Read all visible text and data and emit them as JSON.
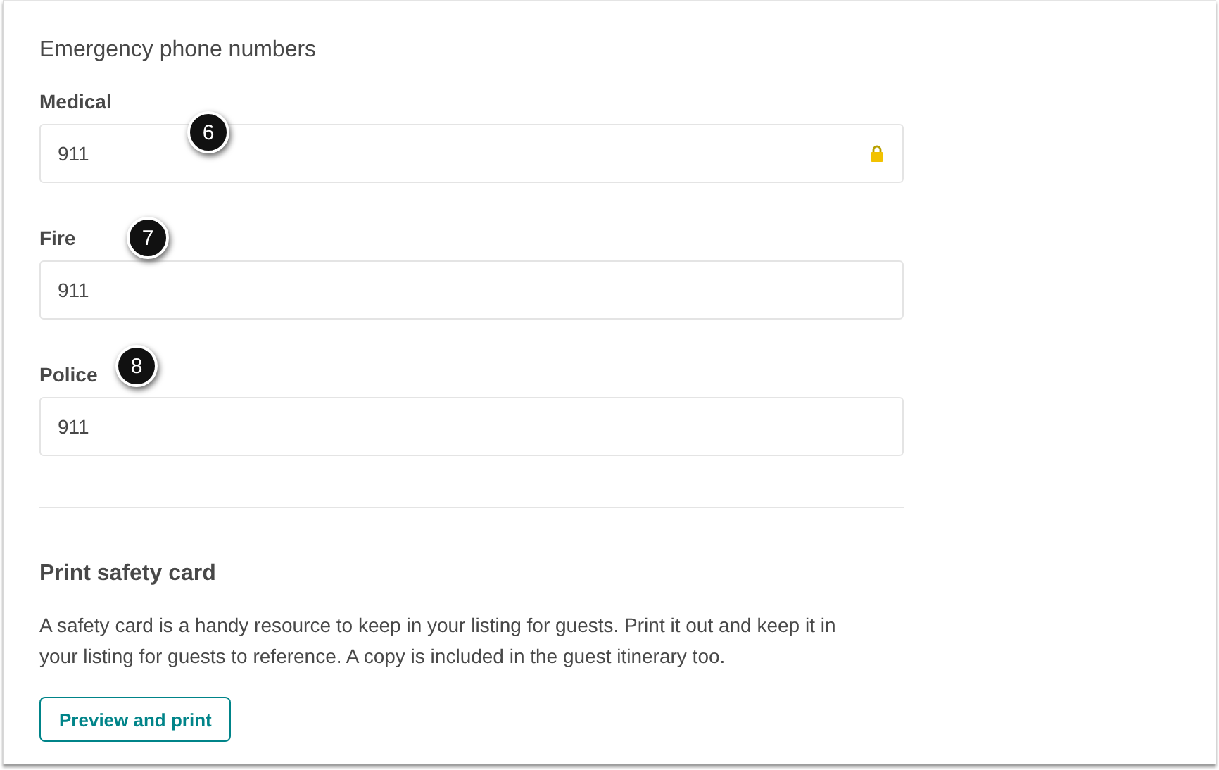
{
  "section_title": "Emergency phone numbers",
  "fields": [
    {
      "label": "Medical",
      "value": "911",
      "locked": true,
      "callout": "6"
    },
    {
      "label": "Fire",
      "value": "911",
      "locked": false,
      "callout": "7"
    },
    {
      "label": "Police",
      "value": "911",
      "locked": false,
      "callout": "8"
    }
  ],
  "safety_card": {
    "title": "Print safety card",
    "description": "A safety card is a handy resource to keep in your listing for guests. Print it out and keep it in your listing for guests to reference. A copy is included in the guest itinerary too.",
    "button": "Preview and print"
  }
}
